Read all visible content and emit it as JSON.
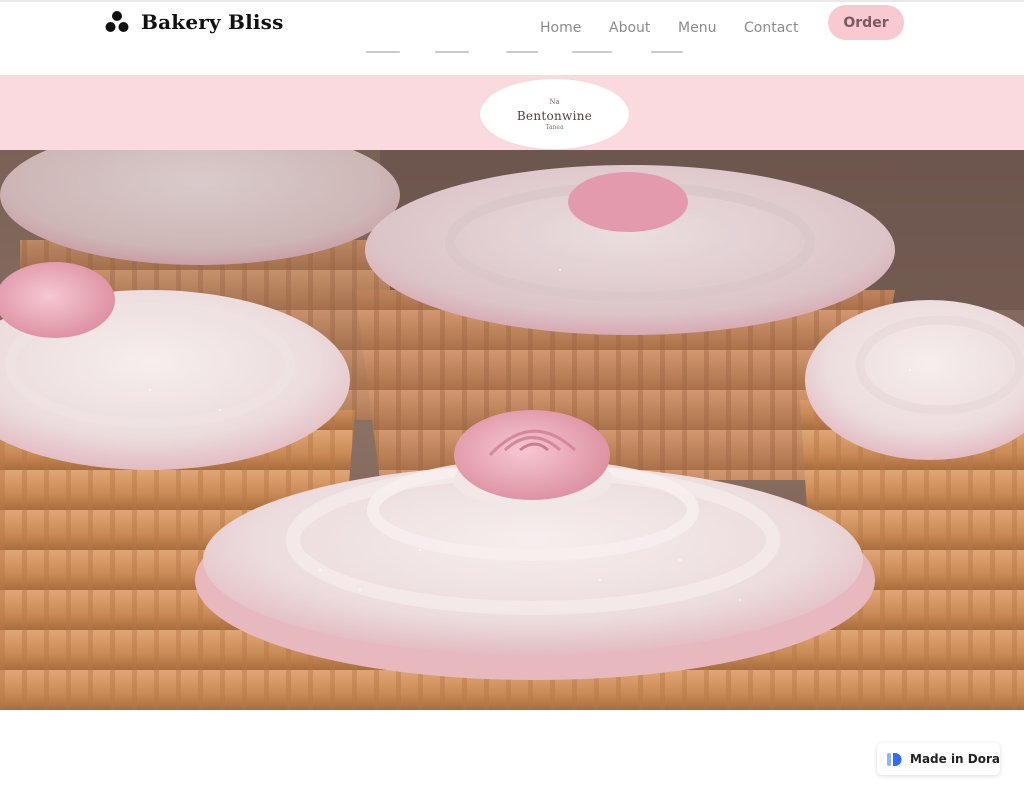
{
  "header": {
    "brand": "Bakery Bliss",
    "logo_icon": "three-dots-logo-icon",
    "nav": {
      "home": "Home",
      "about": "About",
      "menu": "Menu",
      "contact": "Contact"
    },
    "order_label": "Order"
  },
  "banner": {
    "badge_top": "Na",
    "badge_main": "Bentonwine",
    "badge_sub": "Tanea"
  },
  "hero": {
    "image": "pink-frosted-cupcakes-with-sugar-roses-photo"
  },
  "footer_badge": {
    "label": "Made in Dora",
    "icon": "dora-logo-icon"
  },
  "colors": {
    "accent_pink": "#f8c9d0",
    "banner_pink": "#fadadf",
    "nav_text": "#8c8c8c",
    "brand_text": "#111111",
    "dora_blue": "#2f6bff"
  }
}
